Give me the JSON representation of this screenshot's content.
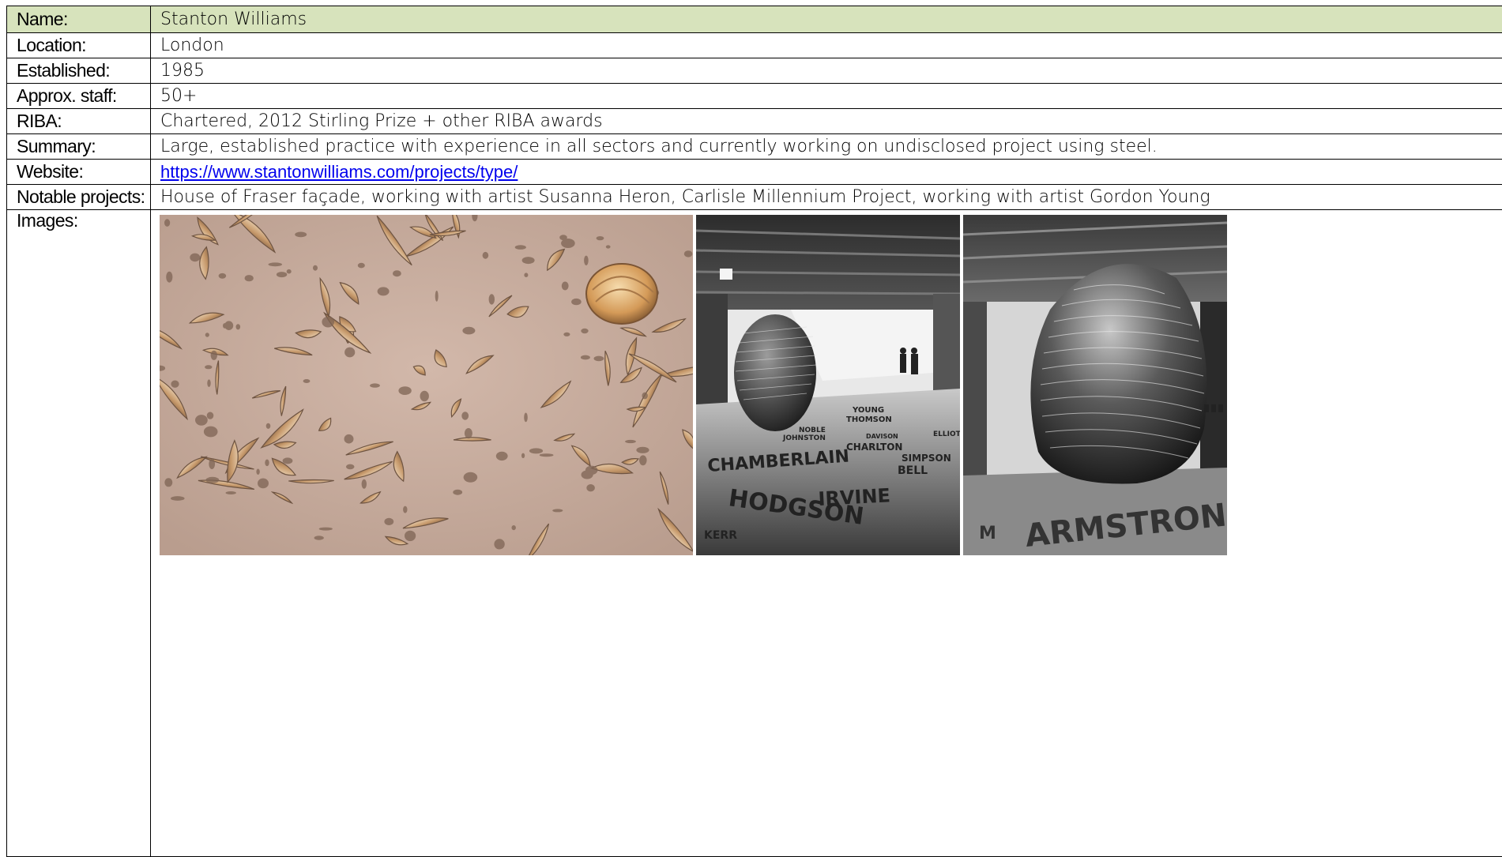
{
  "rows": {
    "name": {
      "label": "Name:",
      "value": "Stanton Williams"
    },
    "location": {
      "label": "Location:",
      "value": "London"
    },
    "established": {
      "label": "Established:",
      "value": "1985"
    },
    "staff": {
      "label": "Approx. staff:",
      "value": "50+"
    },
    "riba": {
      "label": "RIBA:",
      "value": "Chartered, 2012 Stirling Prize + other RIBA awards"
    },
    "summary": {
      "label": "Summary:",
      "value": "Large, established practice with experience in all sectors and currently working on undisclosed project using steel."
    },
    "website": {
      "label": "Website:",
      "value": "https://www.stantonwilliams.com/projects/type/"
    },
    "projects": {
      "label": "Notable projects:",
      "value": "House of Fraser façade, working with artist Susanna Heron, Carlisle Millennium Project, working with artist Gordon Young"
    },
    "images": {
      "label": "Images:"
    }
  },
  "images": [
    {
      "name": "fossil-stone-facade-photo"
    },
    {
      "name": "carlisle-subway-stone-photo"
    },
    {
      "name": "inscribed-boulder-closeup-photo"
    }
  ],
  "colors": {
    "header_bg": "#d7e3bc",
    "link": "#0000ee"
  },
  "image_text": {
    "names": [
      "YOUNG",
      "THOMSON",
      "NOBLE",
      "JOHNSTON",
      "DAVISON",
      "ELLIOT",
      "CHARLTON",
      "SIMPSON",
      "BELL",
      "CHAMBERLAIN",
      "IRVINE",
      "HODGSON",
      "KERR",
      "ARMSTRONG"
    ]
  }
}
